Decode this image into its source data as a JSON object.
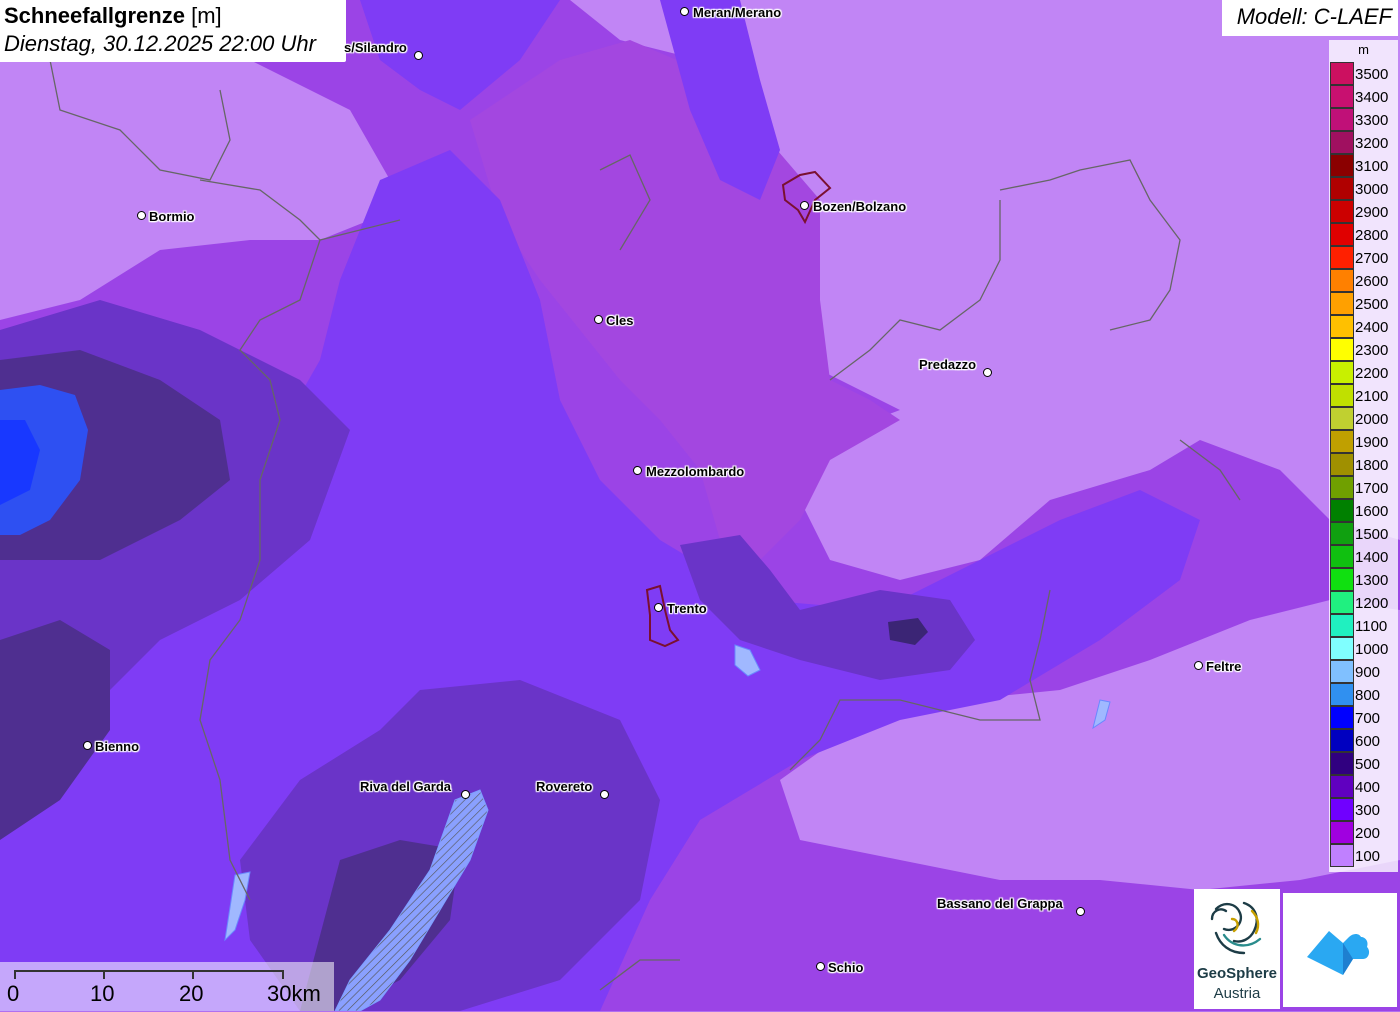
{
  "title": {
    "name": "Schneefallgrenze",
    "unit": "[m]",
    "datetime": "Dienstag, 30.12.2025 22:00 Uhr"
  },
  "model_label": "Modell: C-LAEF",
  "legend": {
    "unit": "m",
    "items": [
      {
        "label": "3500",
        "color": "#cc1060"
      },
      {
        "label": "3400",
        "color": "#c81070"
      },
      {
        "label": "3300",
        "color": "#c01078"
      },
      {
        "label": "3200",
        "color": "#a01060"
      },
      {
        "label": "3100",
        "color": "#8b0000"
      },
      {
        "label": "3000",
        "color": "#b00000"
      },
      {
        "label": "2900",
        "color": "#cc0000"
      },
      {
        "label": "2800",
        "color": "#e00000"
      },
      {
        "label": "2700",
        "color": "#ff2000"
      },
      {
        "label": "2600",
        "color": "#ff8000"
      },
      {
        "label": "2500",
        "color": "#ffa000"
      },
      {
        "label": "2400",
        "color": "#ffc000"
      },
      {
        "label": "2300",
        "color": "#ffff00"
      },
      {
        "label": "2200",
        "color": "#c8f000"
      },
      {
        "label": "2100",
        "color": "#c0e000"
      },
      {
        "label": "2000",
        "color": "#c0d030"
      },
      {
        "label": "1900",
        "color": "#c0a000"
      },
      {
        "label": "1800",
        "color": "#a09000"
      },
      {
        "label": "1700",
        "color": "#70a000"
      },
      {
        "label": "1600",
        "color": "#008000"
      },
      {
        "label": "1500",
        "color": "#10a010"
      },
      {
        "label": "1400",
        "color": "#10c010"
      },
      {
        "label": "1300",
        "color": "#10e010"
      },
      {
        "label": "1200",
        "color": "#20f080"
      },
      {
        "label": "1100",
        "color": "#20f0c0"
      },
      {
        "label": "1000",
        "color": "#80ffff"
      },
      {
        "label": "900",
        "color": "#80c0ff"
      },
      {
        "label": "800",
        "color": "#3090f0"
      },
      {
        "label": "700",
        "color": "#0000ff"
      },
      {
        "label": "600",
        "color": "#0000c0"
      },
      {
        "label": "500",
        "color": "#300080"
      },
      {
        "label": "400",
        "color": "#6000c0"
      },
      {
        "label": "300",
        "color": "#7000ff"
      },
      {
        "label": "200",
        "color": "#a000e0"
      },
      {
        "label": "100",
        "color": "#c080ff"
      }
    ]
  },
  "cities": [
    {
      "name": "Meran/Merano"
    },
    {
      "name": "s/Silandro"
    },
    {
      "name": "Bormio"
    },
    {
      "name": "Bozen/Bolzano"
    },
    {
      "name": "Cles"
    },
    {
      "name": "Predazzo"
    },
    {
      "name": "Mezzolombardo"
    },
    {
      "name": "Trento"
    },
    {
      "name": "Feltre"
    },
    {
      "name": "Bienno"
    },
    {
      "name": "Riva del Garda"
    },
    {
      "name": "Rovereto"
    },
    {
      "name": "Bassano del Grappa"
    },
    {
      "name": "Schio"
    }
  ],
  "scale_bar": {
    "labels": [
      "0",
      "10",
      "20",
      "30km"
    ]
  },
  "logos": {
    "geosphere_name": "GeoSphere",
    "geosphere_sub": "Austria"
  },
  "colors": {
    "level_100": "#c185f5",
    "level_200": "#9b3fe8",
    "level_300": "#7b3af8",
    "level_400": "#6a34c8",
    "level_500": "#4c2d8a",
    "level_700": "#2244ee",
    "lake": "#a0b8ff",
    "border": "#666666"
  }
}
